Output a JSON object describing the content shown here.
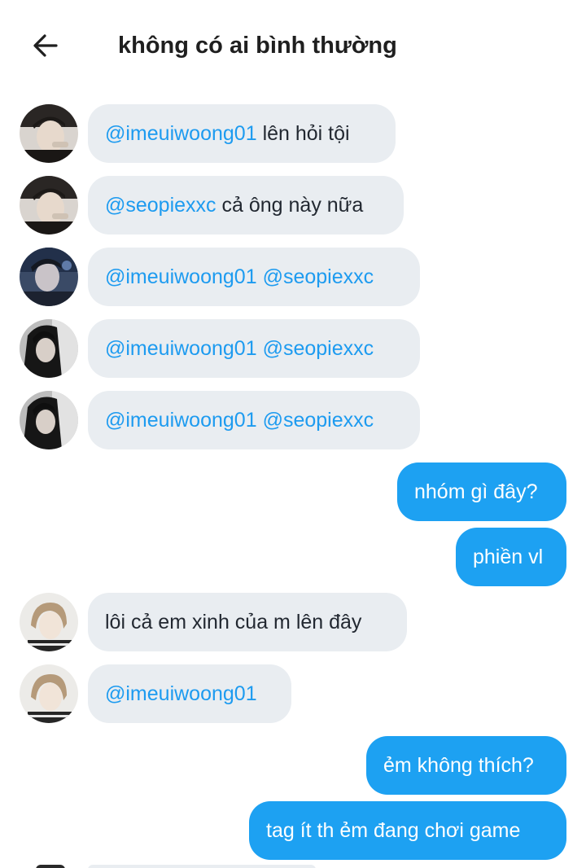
{
  "header": {
    "title": "không có ai bình thường",
    "back_icon": "arrow-left-icon"
  },
  "colors": {
    "incoming_bubble": "#e9edf1",
    "outgoing_bubble": "#1da1f2",
    "mention": "#1d9bf0"
  },
  "messages": [
    {
      "dir": "in",
      "avatar": "user-a",
      "mentions": [
        "@imeuiwoong01"
      ],
      "text": "lên hỏi tội"
    },
    {
      "dir": "in",
      "avatar": "user-a",
      "mentions": [
        "@seopiexxc"
      ],
      "text": "cả ông này nữa"
    },
    {
      "dir": "in",
      "avatar": "user-b",
      "mentions": [
        "@imeuiwoong01",
        "@seopiexxc"
      ],
      "text": ""
    },
    {
      "dir": "in",
      "avatar": "user-c",
      "mentions": [
        "@imeuiwoong01",
        "@seopiexxc"
      ],
      "text": ""
    },
    {
      "dir": "in",
      "avatar": "user-c",
      "mentions": [
        "@imeuiwoong01",
        "@seopiexxc"
      ],
      "text": ""
    },
    {
      "dir": "out",
      "text": "nhóm gì đây?"
    },
    {
      "dir": "out",
      "text": "phiền vl"
    },
    {
      "dir": "in",
      "avatar": "user-d",
      "mentions": [],
      "text": "lôi cả em xinh của m lên đây"
    },
    {
      "dir": "in",
      "avatar": "user-d",
      "mentions": [
        "@imeuiwoong01"
      ],
      "text": ""
    },
    {
      "dir": "out",
      "text": "ẻm không thích?"
    },
    {
      "dir": "out",
      "text": "tag ít th ẻm đang chơi game"
    }
  ]
}
